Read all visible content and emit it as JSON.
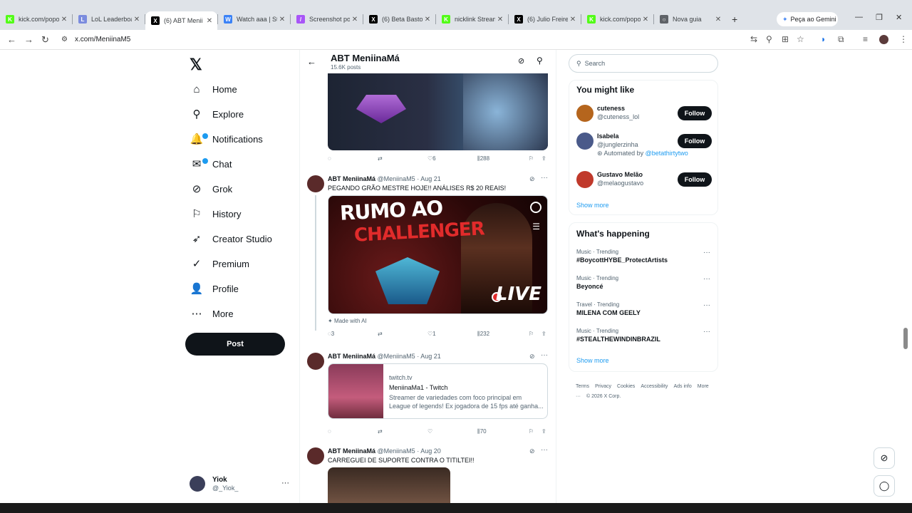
{
  "browser": {
    "tabs": [
      {
        "title": "kick.com/popo",
        "icon": "kick-icon",
        "color": "#53fc18",
        "glyph": "K"
      },
      {
        "title": "LoL Leaderboards",
        "icon": "leaderboard-icon",
        "color": "#7b8cde",
        "glyph": "L"
      },
      {
        "title": "(6) ABT Menii",
        "icon": "x-icon",
        "color": "#000000",
        "glyph": "X",
        "active": true
      },
      {
        "title": "Watch aaa | St",
        "icon": "watch-icon",
        "color": "#3b82f6",
        "glyph": "W"
      },
      {
        "title": "Screenshot po",
        "icon": "screenshot-icon",
        "color": "#a855f7",
        "glyph": "/"
      },
      {
        "title": "(6) Beta Basto",
        "icon": "x-icon",
        "color": "#000000",
        "glyph": "X"
      },
      {
        "title": "nicklink Stream",
        "icon": "kick-icon",
        "color": "#53fc18",
        "glyph": "K"
      },
      {
        "title": "(6) Julio Freire",
        "icon": "x-icon",
        "color": "#000000",
        "glyph": "X"
      },
      {
        "title": "kick.com/popo",
        "icon": "kick-icon",
        "color": "#53fc18",
        "glyph": "K"
      },
      {
        "title": "Nova guia",
        "icon": "globe-icon",
        "color": "#5f6368",
        "glyph": "○"
      }
    ],
    "new_tab": "+",
    "gemini_label": "Peça ao Gemini",
    "url": "x.com/MeniinaM5"
  },
  "nav": {
    "items": [
      {
        "label": "Home",
        "icon": "home-icon",
        "glyph": "⌂"
      },
      {
        "label": "Explore",
        "icon": "search-icon",
        "glyph": "⚲"
      },
      {
        "label": "Notifications",
        "icon": "bell-icon",
        "glyph": "🔔",
        "badge": true
      },
      {
        "label": "Chat",
        "icon": "chat-icon",
        "glyph": "✉",
        "badge": true
      },
      {
        "label": "Grok",
        "icon": "grok-icon",
        "glyph": "⊘"
      },
      {
        "label": "History",
        "icon": "bookmark-icon",
        "glyph": "⚐"
      },
      {
        "label": "Creator Studio",
        "icon": "rocket-icon",
        "glyph": "➶"
      },
      {
        "label": "Premium",
        "icon": "verified-icon",
        "glyph": "✓"
      },
      {
        "label": "Profile",
        "icon": "person-icon",
        "glyph": "👤"
      },
      {
        "label": "More",
        "icon": "more-icon",
        "glyph": "⋯"
      }
    ],
    "post_label": "Post",
    "account": {
      "name": "Yiok",
      "handle": "@_Yiok_",
      "more": "···"
    }
  },
  "feed": {
    "title": "ABT MeniinaMá",
    "subtitle": "15.6K posts",
    "first_actions": {
      "replies": "",
      "reposts": "",
      "likes": "6",
      "views": "288"
    },
    "posts": [
      {
        "name": "ABT MeniinaMá",
        "meta": "@MeniinaM5 · Aug 21",
        "text": "PEGANDO GRÃO MESTRE HOJE!! ANÁLISES R$ 20 REAIS!",
        "media_title_1": "RUMO AO",
        "media_title_2": "CHALLENGER",
        "media_live": "LIVE",
        "ai_label": "Made with AI",
        "replies": "3",
        "reposts": "",
        "likes": "1",
        "views": "232"
      },
      {
        "name": "ABT MeniinaMá",
        "meta": "@MeniinaM5 · Aug 21",
        "card_domain": "twitch.tv",
        "card_title": "MeniinaMa1 - Twitch",
        "card_desc": "Streamer de variedades com foco principal em League of legends! Ex jogadora de 15 fps até ganha...",
        "replies": "",
        "reposts": "",
        "likes": "",
        "views": "70"
      },
      {
        "name": "ABT MeniinaMá",
        "meta": "@MeniinaM5 · Aug 20",
        "text": "CARREGUEI DE SUPORTE CONTRA O TITILTEI!!"
      }
    ]
  },
  "right": {
    "search_placeholder": "Search",
    "might_like_title": "You might like",
    "suggestions": [
      {
        "name": "cuteness",
        "handle": "@cuteness_lol",
        "follow": "Follow",
        "color": "#b5651d"
      },
      {
        "name": "Isabela",
        "handle": "@junglerzinha",
        "extra": "Automated by",
        "extra_link": "@betathirtytwo",
        "follow": "Follow",
        "color": "#4a5a8a"
      },
      {
        "name": "Gustavo Melão",
        "handle": "@melaogustavo",
        "follow": "Follow",
        "color": "#c0392b"
      }
    ],
    "show_more": "Show more",
    "happening_title": "What's happening",
    "trends": [
      {
        "context": "Music · Trending",
        "name": "#BoycottHYBE_ProtectArtists"
      },
      {
        "context": "Music · Trending",
        "name": "Beyoncé"
      },
      {
        "context": "Travel · Trending",
        "name": "MILENA COM GEELY"
      },
      {
        "context": "Music · Trending",
        "name": "#STEALTHEWINDINBRAZIL"
      }
    ],
    "show_more_2": "Show more",
    "footer": [
      "Terms",
      "Privacy",
      "Cookies",
      "Accessibility",
      "Ads info",
      "More ···",
      "© 2026 X Corp."
    ]
  }
}
